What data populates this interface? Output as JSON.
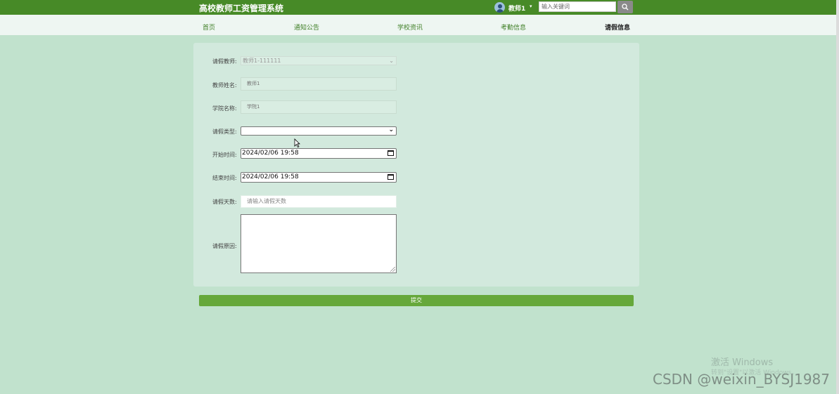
{
  "header": {
    "site_title": "高校教师工资管理系统",
    "user_name": "教师1",
    "user_caret": "▾",
    "search_placeholder": "输入关键词"
  },
  "nav": {
    "items": [
      {
        "label": "首页"
      },
      {
        "label": "通知公告"
      },
      {
        "label": "学校资讯"
      },
      {
        "label": "考勤信息"
      },
      {
        "label": "请假信息",
        "active": true
      }
    ]
  },
  "form": {
    "teacher_label": "请假教师:",
    "teacher_value": "教师1-111111",
    "name_label": "教师姓名:",
    "name_value": "教师1",
    "college_label": "学院名称:",
    "college_value": "学院1",
    "type_label": "请假类型:",
    "type_value": "",
    "start_label": "开始时间:",
    "start_value": "2024/02/06 19:58",
    "end_label": "结束时间:",
    "end_value": "2024/02/06 19:58",
    "days_label": "请假天数:",
    "days_placeholder": "请输入请假天数",
    "reason_label": "请假原因:",
    "reason_value": ""
  },
  "submit_label": "提交",
  "watermarks": {
    "windows_line1": "激活 Windows",
    "windows_line2": "转到\"设置\"以激活 Windows。",
    "csdn": "CSDN @weixin_BYSJ1987"
  },
  "colors": {
    "topbar": "#478a27",
    "page_bg": "#c1e2cd",
    "nav_bg": "#eef6f2",
    "panel_bg": "#d2e9dd",
    "submit_bg": "#66a83a"
  }
}
